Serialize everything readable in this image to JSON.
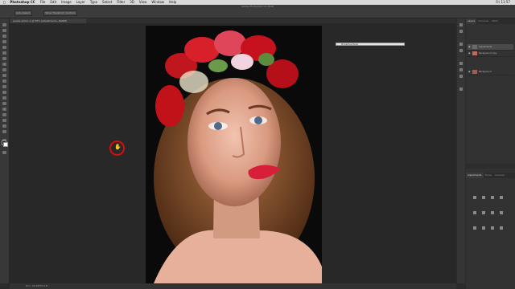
{
  "menubar": {
    "apple": "",
    "items": [
      "Photoshop CC",
      "File",
      "Edit",
      "Image",
      "Layer",
      "Type",
      "Select",
      "Filter",
      "3D",
      "View",
      "Window",
      "Help"
    ],
    "clock": "Fri 11:57"
  },
  "app_title": "Adobe Photoshop CC 2018",
  "options": {
    "btn1": "Auto-Select:",
    "btn2": "Show Transform Controls"
  },
  "document": {
    "tab_label": "pexels-photo-1 @ 50% (Adjustments, RGB/8)",
    "status": "Doc: 24.9M/50.1M"
  },
  "floating_panel": {
    "label": "Properties Panel"
  },
  "panels": {
    "top_tabs": [
      "Layers",
      "Channels",
      "Paths"
    ],
    "layers": [
      {
        "name": "Adjustments",
        "selected": true
      },
      {
        "name": "Background copy",
        "selected": false
      },
      {
        "name": "Background",
        "selected": false
      }
    ],
    "mid_tabs": [
      "Adjustments",
      "Styles",
      "Libraries"
    ]
  }
}
